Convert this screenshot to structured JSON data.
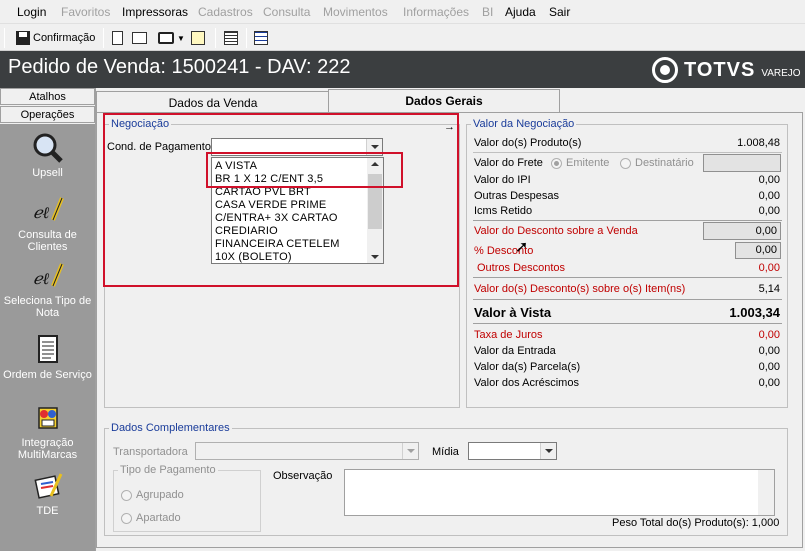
{
  "menu": {
    "items": [
      {
        "label": "Login",
        "enabled": true
      },
      {
        "label": "Favoritos",
        "enabled": false
      },
      {
        "label": "Impressoras",
        "enabled": true
      },
      {
        "label": "Cadastros",
        "enabled": false
      },
      {
        "label": "Consulta",
        "enabled": false
      },
      {
        "label": "Movimentos",
        "enabled": false
      },
      {
        "label": "Informações",
        "enabled": false
      },
      {
        "label": "BI",
        "enabled": false
      },
      {
        "label": "Ajuda",
        "enabled": true
      },
      {
        "label": "Sair",
        "enabled": true
      }
    ]
  },
  "toolbar": {
    "confirm_label": "Confirmação"
  },
  "header": {
    "title": "Pedido de Venda: 1500241  - DAV: 222",
    "logo_brand": "TOTVS",
    "logo_sub": "VAREJO"
  },
  "sidebar": {
    "atalhos": "Atalhos",
    "operacoes": "Operações",
    "buttons": [
      {
        "label": "Upsell",
        "icon": "magnifier-icon"
      },
      {
        "label": "Consulta de Clientes",
        "icon": "pen-icon"
      },
      {
        "label": "Seleciona Tipo de Nota",
        "icon": "pen-icon"
      },
      {
        "label": "Ordem de Serviço",
        "icon": "document-icon"
      },
      {
        "label": "Integração MultiMarcas",
        "icon": "integration-icon"
      },
      {
        "label": "TDE",
        "icon": "tde-icon"
      }
    ]
  },
  "tabs": {
    "dados_venda": "Dados da Venda",
    "dados_gerais": "Dados Gerais"
  },
  "negociacao": {
    "title": "Negociação",
    "cond_label": "Cond. de Pagamento",
    "cond_value": "",
    "options": [
      "A VISTA",
      "BR 1 X 12 C/ENT 3,5",
      "CARTAO PVL BRT",
      "CASA VERDE PRIME",
      "C/ENTRA+ 3X CARTAO",
      "CREDIARIO",
      "FINANCEIRA CETELEM",
      "10X (BOLETO)"
    ]
  },
  "valor_negociacao": {
    "title": "Valor da Negociação",
    "produtos_label": "Valor do(s) Produto(s)",
    "produtos_value": "1.008,48",
    "frete_label": "Valor do Frete",
    "frete_emitente": "Emitente",
    "frete_destinatario": "Destinatário",
    "frete_value": "",
    "ipi_label": "Valor do IPI",
    "ipi_value": "0,00",
    "outras_label": "Outras Despesas",
    "outras_value": "0,00",
    "icms_label": "Icms Retido",
    "icms_value": "0,00",
    "desconto_venda_label": "Valor do Desconto sobre a Venda",
    "desconto_venda_value": "0,00",
    "pct_desconto_label": "% Desconto",
    "pct_desconto_value": "0,00",
    "outros_descontos_label": "Outros Descontos",
    "outros_descontos_value": "0,00",
    "desconto_itens_label": "Valor do(s) Desconto(s) sobre o(s) Item(ns)",
    "desconto_itens_value": "5,14",
    "valor_vista_label": "Valor à Vista",
    "valor_vista_value": "1.003,34",
    "taxa_juros_label": "Taxa de Juros",
    "taxa_juros_value": "0,00",
    "entrada_label": "Valor da Entrada",
    "entrada_value": "0,00",
    "parcelas_label": "Valor da(s) Parcela(s)",
    "parcelas_value": "0,00",
    "acrescimos_label": "Valor dos Acréscimos",
    "acrescimos_value": "0,00"
  },
  "complementares": {
    "title": "Dados Complementares",
    "transportadora_label": "Transportadora",
    "midia_label": "Mídia",
    "tipo_pagamento_title": "Tipo de Pagamento",
    "agrupado": "Agrupado",
    "apartado": "Apartado",
    "observacao_label": "Observação",
    "peso_total": "Peso Total do(s) Produto(s): 1,000"
  },
  "colors": {
    "title_bg": "#3b3e40",
    "sidebar_bg": "#9a9a9a",
    "highlight_red": "#d0102a",
    "group_title": "#1a3c9a"
  }
}
